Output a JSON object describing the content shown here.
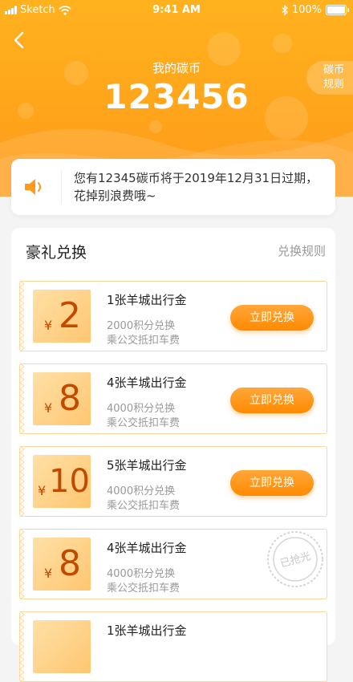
{
  "status_bar": {
    "carrier": "Sketch",
    "time": "9:41 AM",
    "battery": "100%"
  },
  "header": {
    "title": "我的碳币",
    "amount": "123456",
    "rules_line1": "碳币",
    "rules_line2": "规则"
  },
  "notice": {
    "text": "您有12345碳币将于2019年12月31日过期，花掉别浪费哦~"
  },
  "exchange": {
    "title": "豪礼兑换",
    "rules_link": "兑换规则",
    "currency_symbol": "¥",
    "items": [
      {
        "value": "2",
        "name": "1张羊城出行金",
        "points": "2000积分兑换",
        "desc": "乘公交抵扣车费",
        "button": "立即兑换"
      },
      {
        "value": "8",
        "name": "4张羊城出行金",
        "points": "4000积分兑换",
        "desc": "乘公交抵扣车费",
        "button": "立即兑换"
      },
      {
        "value": "10",
        "name": "5张羊城出行金",
        "points": "4000积分兑换",
        "desc": "乘公交抵扣车费",
        "button": "立即兑换"
      },
      {
        "value": "8",
        "name": "4张羊城出行金",
        "points": "4000积分兑换",
        "desc": "乘公交抵扣车费",
        "stamp": "已抢光"
      },
      {
        "name": "1张羊城出行金"
      }
    ]
  },
  "colors": {
    "header": "#ffa51b",
    "accent": "#ff8a00",
    "coupon_text": "#c04a00"
  }
}
